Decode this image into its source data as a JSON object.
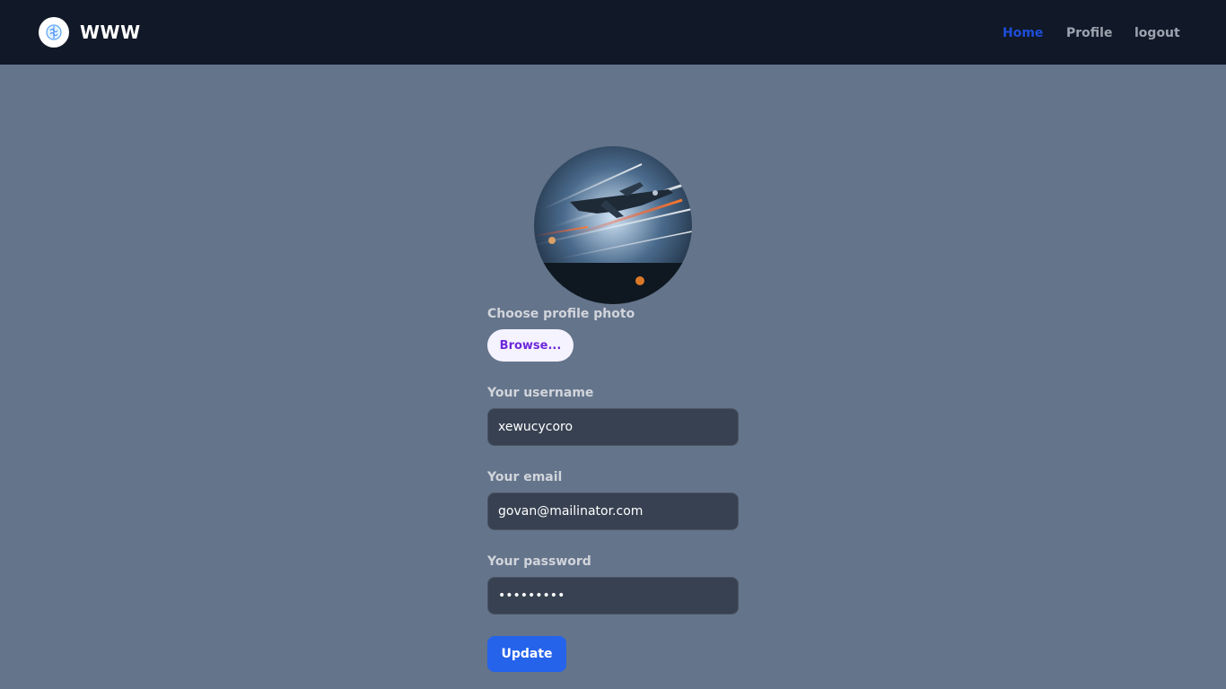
{
  "navbar": {
    "brand": "WWW",
    "logo_icon": "brain-icon",
    "links": [
      {
        "label": "Home",
        "active": true
      },
      {
        "label": "Profile",
        "active": false
      },
      {
        "label": "logout",
        "active": false
      }
    ]
  },
  "form": {
    "photo_label": "Choose profile photo",
    "browse_label": "Browse...",
    "username_label": "Your username",
    "username_value": "xewucycoro",
    "email_label": "Your email",
    "email_value": "govan@mailinator.com",
    "password_label": "Your password",
    "password_value": "123456789",
    "submit_label": "Update"
  },
  "colors": {
    "navbar_bg": "#111827",
    "page_bg": "#64748b",
    "active_link": "#1d4ed8",
    "primary_button": "#2563eb",
    "browse_text": "#6d28d9"
  }
}
